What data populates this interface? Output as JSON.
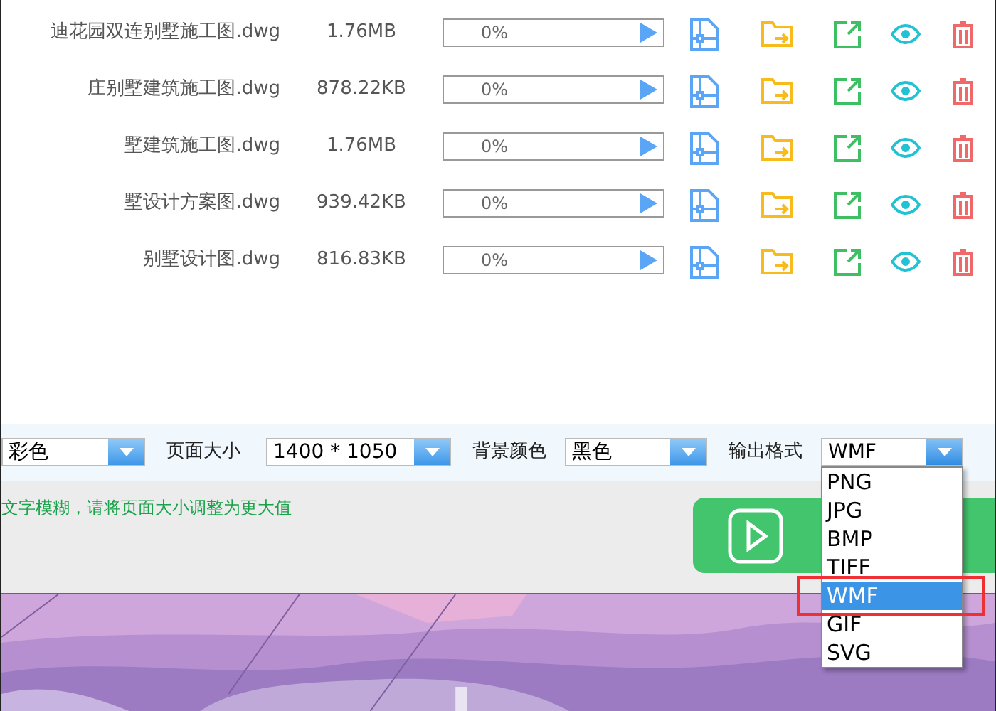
{
  "files": [
    {
      "name": "迪花园双连别墅施工图.dwg",
      "size": "1.76MB",
      "progress": "0%",
      "level": 0
    },
    {
      "name": "庄别墅建筑施工图.dwg",
      "size": "878.22KB",
      "progress": "0%",
      "level": 0
    },
    {
      "name": "墅建筑施工图.dwg",
      "size": "1.76MB",
      "progress": "0%",
      "level": 0
    },
    {
      "name": "墅设计方案图.dwg",
      "size": "939.42KB",
      "progress": "0%",
      "level": 0
    },
    {
      "name": "别墅设计图.dwg",
      "size": "816.83KB",
      "progress": "0%",
      "level": 0
    }
  ],
  "settings": {
    "color_mode": {
      "value": "彩色"
    },
    "page_size": {
      "label": "页面大小",
      "value": "1400 * 1050"
    },
    "background": {
      "label": "背景颜色",
      "value": "黑色"
    },
    "output_format": {
      "label": "输出格式",
      "value": "WMF",
      "expanded": true,
      "options": [
        {
          "label": "PNG",
          "selected": false
        },
        {
          "label": "JPG",
          "selected": false
        },
        {
          "label": "BMP",
          "selected": false
        },
        {
          "label": "TIFF",
          "selected": false
        },
        {
          "label": "WMF",
          "selected": true
        },
        {
          "label": "GIF",
          "selected": false
        },
        {
          "label": "SVG",
          "selected": false
        }
      ]
    }
  },
  "hint": "文字模糊，请将页面大小调整为更大值"
}
